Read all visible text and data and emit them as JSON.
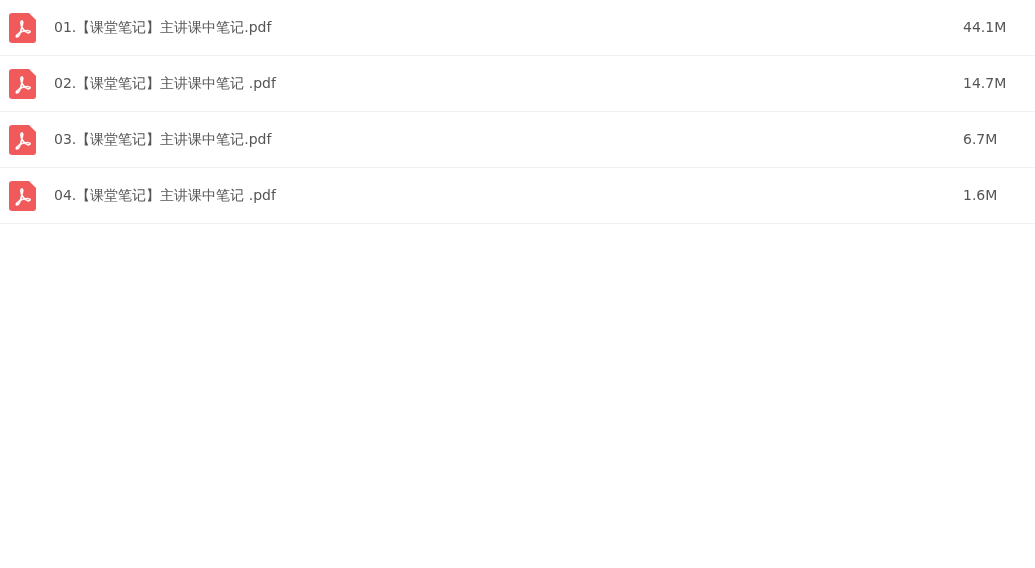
{
  "files": [
    {
      "name": "01.【课堂笔记】主讲课中笔记.pdf",
      "size": "44.1M",
      "kind": "pdf"
    },
    {
      "name": "02.【课堂笔记】主讲课中笔记 .pdf",
      "size": "14.7M",
      "kind": "pdf"
    },
    {
      "name": "03.【课堂笔记】主讲课中笔记.pdf",
      "size": "6.7M",
      "kind": "pdf"
    },
    {
      "name": "04.【课堂笔记】主讲课中笔记 .pdf",
      "size": "1.6M",
      "kind": "pdf"
    }
  ]
}
